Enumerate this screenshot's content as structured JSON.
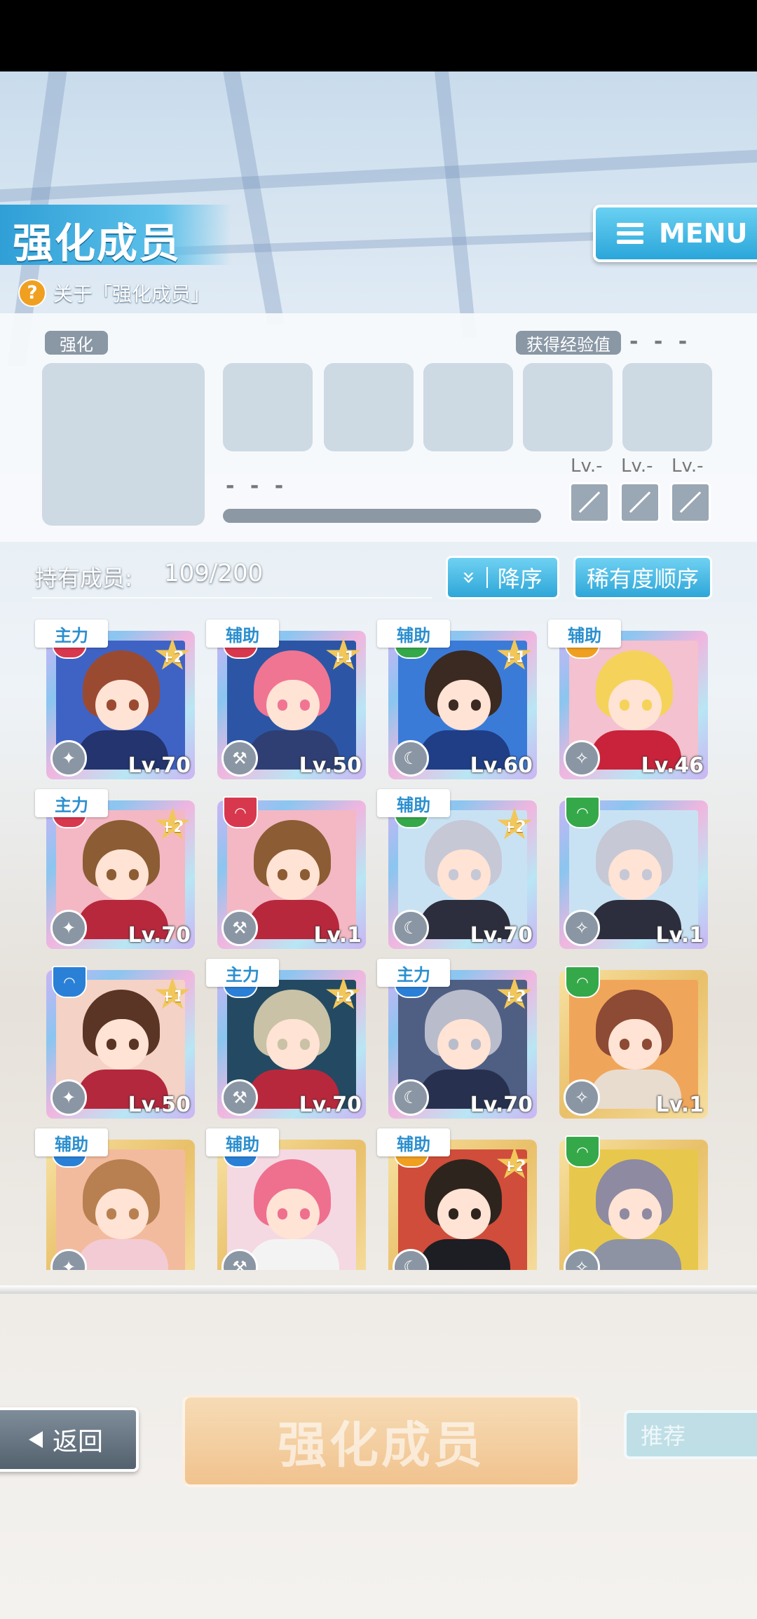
{
  "header": {
    "title": "强化成员",
    "help_text": "关于「强化成员」",
    "help_icon": "?",
    "menu_label": "MENU"
  },
  "panel": {
    "enhance_label": "强化",
    "exp_label": "获得经验值",
    "exp_value": "- - -",
    "bar_value": "- - -",
    "skill_levels": [
      "Lv.-",
      "Lv.-",
      "Lv.-"
    ]
  },
  "members": {
    "label": "持有成员:",
    "count": "109/200",
    "sort_desc": "降序",
    "sort_desc_icon": "»",
    "sort_rarity": "稀有度顺序"
  },
  "cards": [
    {
      "role": "主力",
      "plus": "+2",
      "level": "Lv.70",
      "badge": "red",
      "frame": "rainbow",
      "hair": "#9b4a32",
      "bg": "#3f63c4",
      "outfit": "#23346e"
    },
    {
      "role": "辅助",
      "plus": "+1",
      "level": "Lv.50",
      "badge": "red",
      "frame": "rainbow",
      "hair": "#f07592",
      "bg": "#2c56a5",
      "outfit": "#2f3f74"
    },
    {
      "role": "辅助",
      "plus": "+1",
      "level": "Lv.60",
      "badge": "green",
      "frame": "rainbow",
      "hair": "#3a2a22",
      "bg": "#3b7bd8",
      "outfit": "#1f3e86"
    },
    {
      "role": "辅助",
      "plus": "",
      "level": "Lv.46",
      "badge": "orange",
      "frame": "rainbow",
      "hair": "#f5d35a",
      "bg": "#f3c1cf",
      "outfit": "#c8233a"
    },
    {
      "role": "主力",
      "plus": "+2",
      "level": "Lv.70",
      "badge": "red",
      "frame": "rainbow",
      "hair": "#8c5c34",
      "bg": "#f3b8c4",
      "outfit": "#b8283c"
    },
    {
      "role": "",
      "plus": "",
      "level": "Lv.1",
      "badge": "red",
      "frame": "rainbow",
      "hair": "#8c5c34",
      "bg": "#f3b8c4",
      "outfit": "#b8283c"
    },
    {
      "role": "辅助",
      "plus": "+2",
      "level": "Lv.70",
      "badge": "green",
      "frame": "rainbow",
      "hair": "#c6c8d6",
      "bg": "#c9e2f3",
      "outfit": "#2d2e3d"
    },
    {
      "role": "",
      "plus": "",
      "level": "Lv.1",
      "badge": "green",
      "frame": "rainbow",
      "hair": "#c6c8d6",
      "bg": "#c9e2f3",
      "outfit": "#2d2e3d"
    },
    {
      "role": "",
      "plus": "+1",
      "level": "Lv.50",
      "badge": "blue",
      "frame": "rainbow",
      "hair": "#5a3424",
      "bg": "#f4d2c6",
      "outfit": "#b3283c"
    },
    {
      "role": "主力",
      "plus": "+2",
      "level": "Lv.70",
      "badge": "blue",
      "frame": "rainbow",
      "hair": "#c9c2a6",
      "bg": "#234a62",
      "outfit": "#b8283c"
    },
    {
      "role": "主力",
      "plus": "+2",
      "level": "Lv.70",
      "badge": "blue",
      "frame": "rainbow",
      "hair": "#b9bccb",
      "bg": "#4f5f84",
      "outfit": "#27314f"
    },
    {
      "role": "",
      "plus": "",
      "level": "Lv.1",
      "badge": "green",
      "frame": "gold",
      "hair": "#8d4a34",
      "bg": "#f0a65a",
      "outfit": "#e8dccf"
    },
    {
      "role": "辅助",
      "plus": "",
      "level": "",
      "badge": "blue",
      "frame": "gold",
      "hair": "#b88050",
      "bg": "#f3bb9d",
      "outfit": "#f3cbd5"
    },
    {
      "role": "辅助",
      "plus": "",
      "level": "",
      "badge": "blue",
      "frame": "gold",
      "hair": "#ef6f8f",
      "bg": "#f4d9e2",
      "outfit": "#f3f3f3"
    },
    {
      "role": "辅助",
      "plus": "+2",
      "level": "",
      "badge": "orange",
      "frame": "gold",
      "hair": "#2e241e",
      "bg": "#cf4d3a",
      "outfit": "#1d1d24"
    },
    {
      "role": "",
      "plus": "",
      "level": "",
      "badge": "green",
      "frame": "gold",
      "hair": "#8e8aa2",
      "bg": "#e8c84c",
      "outfit": "#8e93a3"
    }
  ],
  "footer": {
    "back_label": "返回",
    "main_action": "强化成员",
    "recommend_label": "推荐"
  },
  "colors": {
    "red": "#d8384e",
    "green": "#35a84a",
    "blue": "#2a80d6",
    "orange": "#f0a020"
  }
}
